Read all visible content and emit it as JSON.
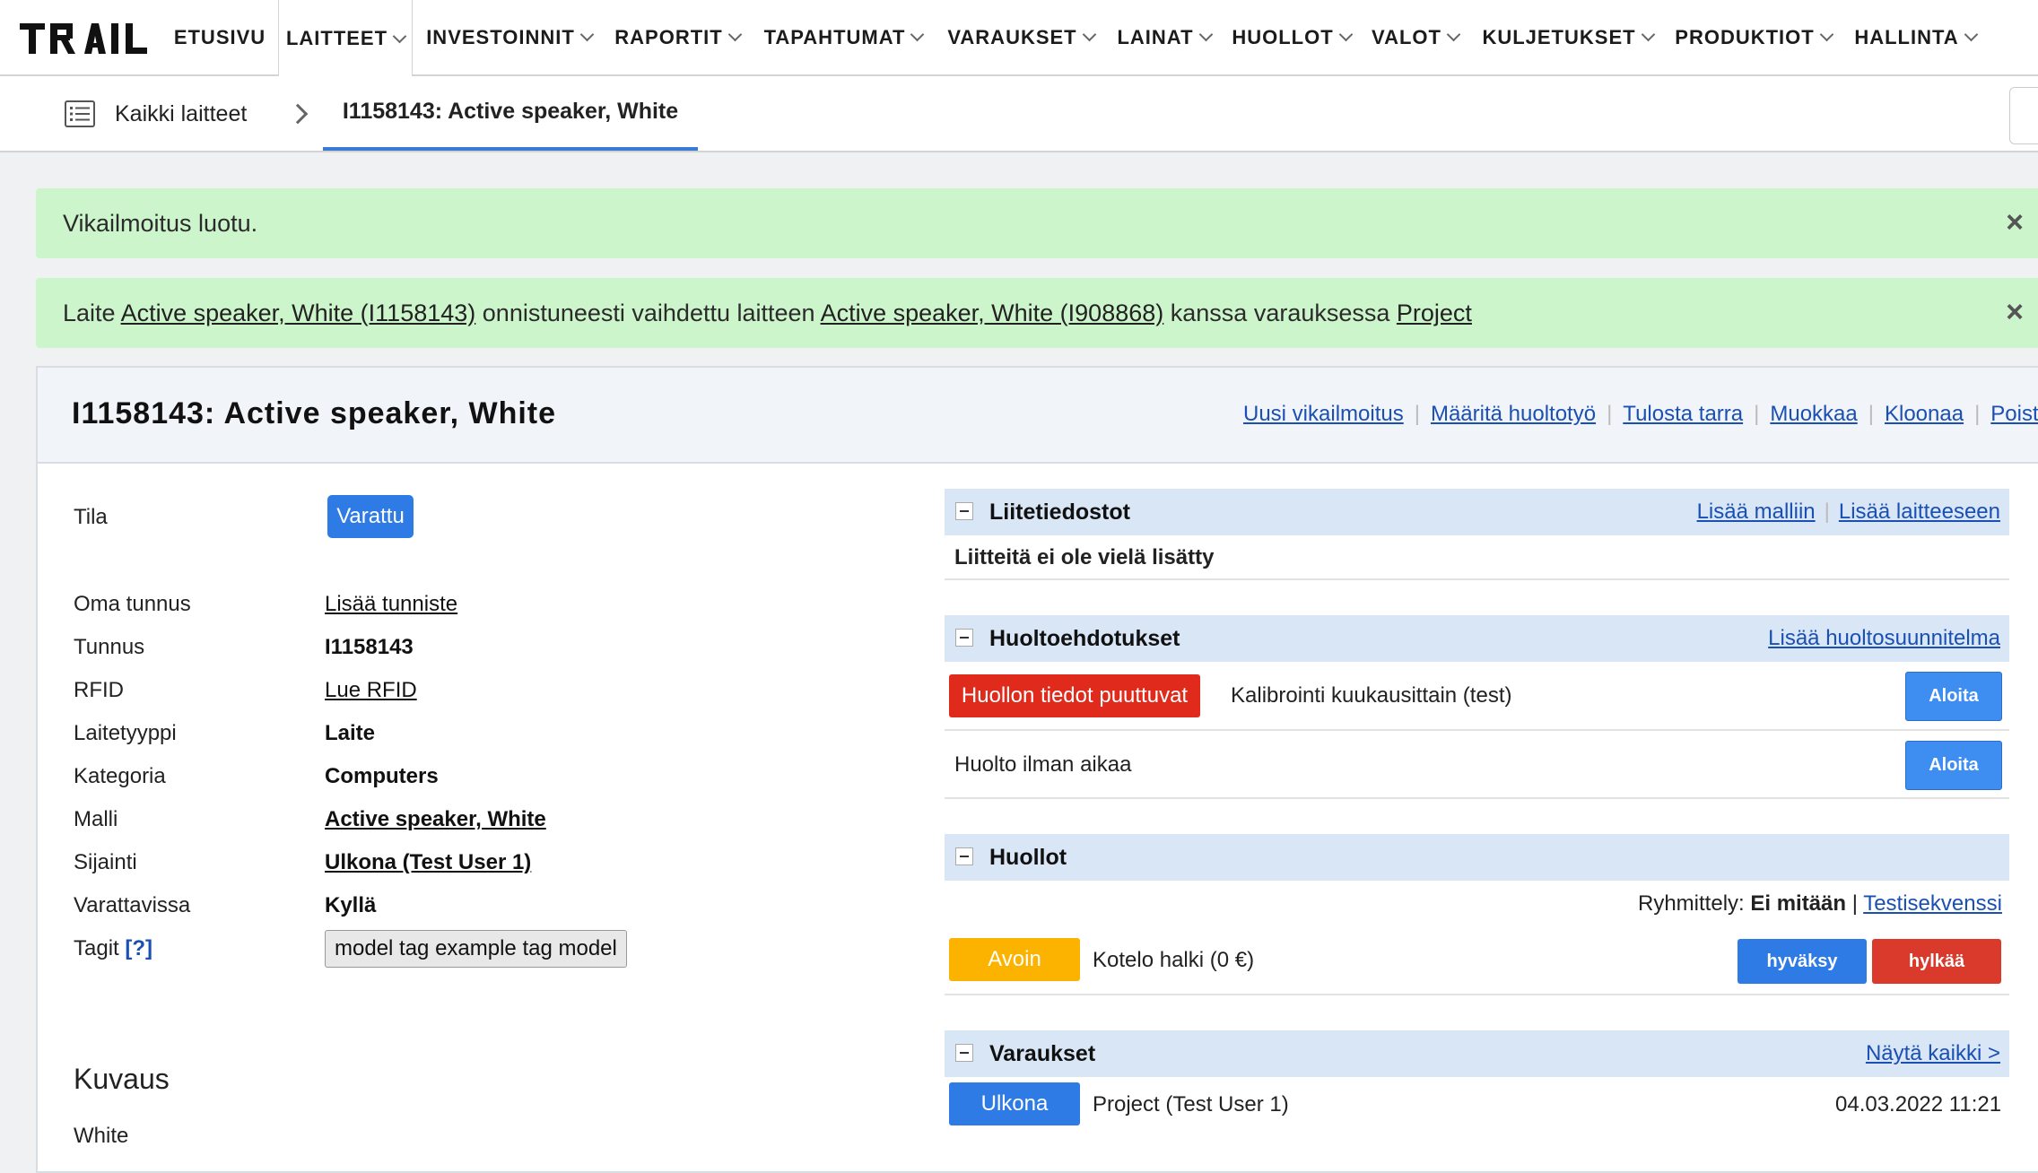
{
  "app": {
    "logo_text": "TRAIL"
  },
  "nav": [
    {
      "label": "ETUSIVU"
    },
    {
      "label": "LAITTEET"
    },
    {
      "label": "INVESTOINNIT"
    },
    {
      "label": "RAPORTIT"
    },
    {
      "label": "TAPAHTUMAT"
    },
    {
      "label": "VARAUKSET"
    },
    {
      "label": "LAINAT"
    },
    {
      "label": "HUOLLOT"
    },
    {
      "label": "VALOT"
    },
    {
      "label": "KULJETUKSET"
    },
    {
      "label": "PRODUKTIOT"
    },
    {
      "label": "HALLINTA"
    }
  ],
  "breadcrumb": {
    "all": "Kaikki laitteet",
    "current": "I1158143: Active speaker, White"
  },
  "alerts": {
    "first": "Vikailmoitus luotu.",
    "second": {
      "t1": "Laite ",
      "link1": "Active speaker, White (I1158143)",
      "t2": " onnistuneesti vaihdettu laitteen ",
      "link2": "Active speaker, White (I908868)",
      "t3": " kanssa varauksessa ",
      "link3": "Project"
    },
    "close": "×"
  },
  "panel": {
    "title": "I1158143: Active speaker, White",
    "actions": [
      "Uusi vikailmoitus",
      "Määritä huoltotyö",
      "Tulosta tarra",
      "Muokkaa",
      "Kloonaa",
      "Poista"
    ]
  },
  "info": {
    "tila_label": "Tila",
    "tila_value": "Varattu",
    "oma_label": "Oma tunnus",
    "oma_value": "Lisää tunniste",
    "tunnus_label": "Tunnus",
    "tunnus_value": "I1158143",
    "rfid_label": "RFID",
    "rfid_value": "Lue RFID",
    "tyyppi_label": "Laitetyyppi",
    "tyyppi_value": "Laite",
    "kategoria_label": "Kategoria",
    "kategoria_value": "Computers",
    "malli_label": "Malli",
    "malli_value": "Active speaker, White",
    "sijainti_label": "Sijainti",
    "sijainti_value": "Ulkona (Test User 1)",
    "varattavissa_label": "Varattavissa",
    "varattavissa_value": "Kyllä",
    "tagit_label": "Tagit",
    "tagit_help": "[?]",
    "tagit_value": "model tag example tag model",
    "kuvaus_title": "Kuvaus",
    "kuvaus_text": "White"
  },
  "liitetiedostot": {
    "title": "Liitetiedostot",
    "links": [
      "Lisää malliin",
      "Lisää laitteeseen"
    ],
    "empty": "Liitteitä ei ole vielä lisätty"
  },
  "huoltoehdotukset": {
    "title": "Huoltoehdotukset",
    "link": "Lisää huoltosuunnitelma",
    "row1_badge": "Huollon tiedot puuttuvat",
    "row1_text": "Kalibrointi kuukausittain (test)",
    "row1_button": "Aloita",
    "row2_text": "Huolto ilman aikaa",
    "row2_button": "Aloita"
  },
  "huollot": {
    "title": "Huollot",
    "grouping_label": "Ryhmittely:",
    "grouping_value": "Ei mitään",
    "grouping_sep": "|",
    "grouping_link": "Testisekvenssi",
    "row_badge": "Avoin",
    "row_text": "Kotelo halki (0 €)",
    "approve": "hyväksy",
    "reject": "hylkää"
  },
  "varaukset": {
    "title": "Varaukset",
    "link": "Näytä kaikki >",
    "row_badge": "Ulkona",
    "row_text": "Project (Test User 1)",
    "row_date": "04.03.2022 11:21"
  },
  "colors": {
    "accent_blue": "#2f7be5",
    "alert_green": "#cdf5cb",
    "danger_red": "#e02b1c",
    "warning_orange": "#fbb300",
    "section_blue": "#d8e6f5"
  }
}
